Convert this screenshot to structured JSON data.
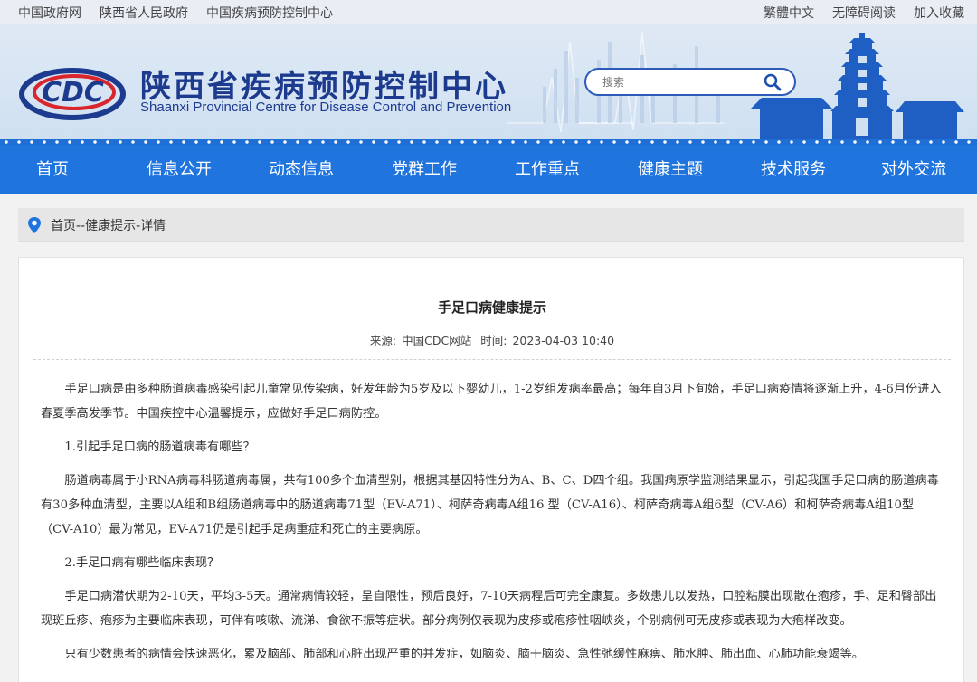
{
  "topbar": {
    "left_links": [
      "中国政府网",
      "陕西省人民政府",
      "中国疾病预防控制中心"
    ],
    "right_links": [
      "繁體中文",
      "无障碍阅读",
      "加入收藏"
    ]
  },
  "header": {
    "logo_text": "CDC",
    "title_cn": "陕西省疾病预防控制中心",
    "title_en": "Shaanxi Provincial Centre for Disease Control and Prevention",
    "search_placeholder": "搜索"
  },
  "nav": {
    "items": [
      "首页",
      "信息公开",
      "动态信息",
      "党群工作",
      "工作重点",
      "健康主题",
      "技术服务",
      "对外交流"
    ]
  },
  "breadcrumb": {
    "text": "首页--健康提示-详情"
  },
  "article": {
    "title": "手足口病健康提示",
    "source_label": "来源:",
    "source": "中国CDC网站",
    "time_label": "时间:",
    "time": "2023-04-03 10:40",
    "paragraphs": [
      "手足口病是由多种肠道病毒感染引起儿童常见传染病，好发年龄为5岁及以下婴幼儿，1-2岁组发病率最高；每年自3月下旬始，手足口病疫情将逐渐上升，4-6月份进入春夏季高发季节。中国疾控中心温馨提示，应做好手足口病防控。",
      "1.引起手足口病的肠道病毒有哪些？",
      "肠道病毒属于小RNA病毒科肠道病毒属，共有100多个血清型别，根据其基因特性分为A、B、C、D四个组。我国病原学监测结果显示，引起我国手足口病的肠道病毒有30多种血清型，主要以A组和B组肠道病毒中的肠道病毒71型（EV-A71）、柯萨奇病毒A组16 型（CV-A16）、柯萨奇病毒A组6型（CV-A6）和柯萨奇病毒A组10型（CV-A10）最为常见，EV-A71仍是引起手足病重症和死亡的主要病原。",
      "2.手足口病有哪些临床表现？",
      "手足口病潜伏期为2-10天，平均3-5天。通常病情较轻，呈自限性，预后良好，7-10天病程后可完全康复。多数患儿以发热，口腔粘膜出现散在疱疹，手、足和臀部出现斑丘疹、疱疹为主要临床表现，可伴有咳嗽、流涕、食欲不振等症状。部分病例仅表现为皮疹或疱疹性咽峡炎，个别病例可无皮疹或表现为大疱样改变。",
      "只有少数患者的病情会快速恶化，累及脑部、肺部和心脏出现严重的并发症，如脑炎、脑干脑炎、急性弛缓性麻痹、肺水肿、肺出血、心肺功能衰竭等。"
    ]
  }
}
